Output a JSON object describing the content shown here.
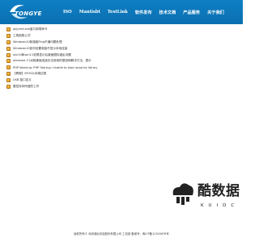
{
  "header": {
    "logo_text": "TONGYE",
    "nav": [
      "ISO",
      "Mantisbt",
      "TestLink",
      "软件发布",
      "技术文档",
      "产品服务",
      "关于我们"
    ]
  },
  "list": [
    "qq\\cmd.exe窗口卸载命令",
    "工具函数公式",
    "Windows10新增组Ping不通问题处理",
    "Windows10如何设置电脑不显示本地连接",
    "win10和win11双屏显示后桌面图标错乱问题",
    "windows 11远程桌面连接无法使用的原因和解决方法，提示",
    "PHP Warning: PHP Startup: Unable to load dynamic library",
    "【教程】MYSQL存储过程",
    "USB 接口定义",
    "要坚持你所做的工作"
  ],
  "watermark": {
    "title": "酷数据",
    "subtitle": "KUIDC"
  },
  "footer": {
    "text": "版权所有© 深圳通业科技股份有限公司 工信部 备案号：粤ICP备12345678号"
  },
  "colors": {
    "header_bg": "#0f7fc4",
    "bullet": "#e59a1a"
  }
}
